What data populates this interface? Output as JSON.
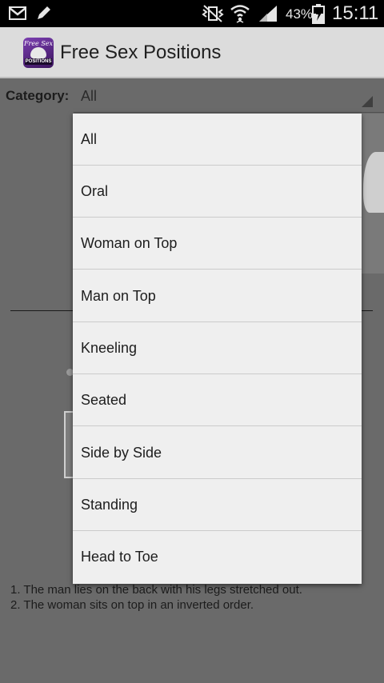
{
  "status_bar": {
    "icons": [
      "gmail-icon",
      "pencil-icon",
      "mute-vibrate-icon",
      "wifi-icon",
      "signal-icon",
      "battery-icon"
    ],
    "battery_percent": "43%",
    "time": "15:11"
  },
  "app_bar": {
    "title": "Free Sex Positions",
    "icon_text_top": "Free Sex",
    "icon_text_bottom": "POSITIONS"
  },
  "filter": {
    "label": "Category:",
    "selected": "All"
  },
  "dropdown": {
    "options": [
      "All",
      "Oral",
      "Woman on Top",
      "Man on Top",
      "Kneeling",
      "Seated",
      "Side by Side",
      "Standing",
      "Head to Toe"
    ]
  },
  "description": {
    "lines": [
      "1. The man lies on the back with his legs stretched out.",
      "2. The woman sits on top in an inverted order."
    ]
  },
  "colors": {
    "status_bar": "#000000",
    "action_bar": "#dcdcdc",
    "dim_background": "#6a6a6a",
    "dropdown_bg": "#efefef"
  }
}
